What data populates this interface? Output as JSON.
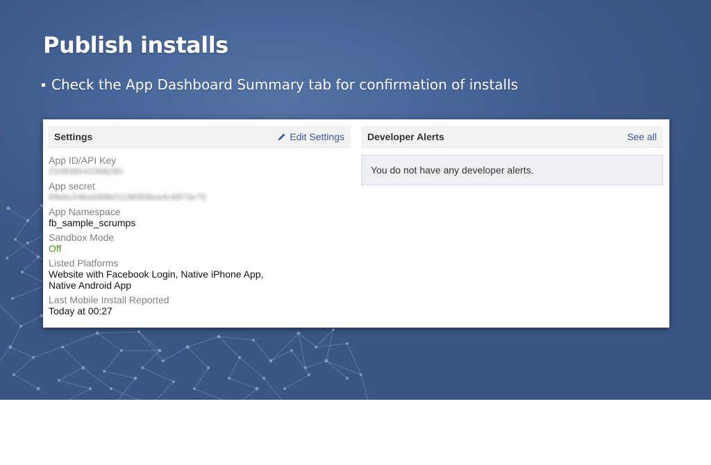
{
  "slide": {
    "title": "Publish installs",
    "bullet": "Check the App Dashboard Summary tab for confirmation of installs"
  },
  "settings": {
    "title": "Settings",
    "edit_link": "Edit Settings",
    "edit_icon": "pencil-icon",
    "fields": [
      {
        "label": "App ID/API Key",
        "value": "233936543368280"
      },
      {
        "label": "App secret",
        "value": "89ebc04ba569b01196909ea4c6873e75"
      },
      {
        "label": "App Namespace",
        "value": "fb_sample_scrumps"
      },
      {
        "label": "Sandbox Mode",
        "value": "Off"
      },
      {
        "label": "Listed Platforms",
        "value": "Website with Facebook Login, Native iPhone App,",
        "value2": "Native Android App"
      },
      {
        "label": "Last Mobile Install Reported",
        "value": "Today at 00:27"
      }
    ]
  },
  "alerts": {
    "title": "Developer Alerts",
    "see_all": "See all",
    "message": "You do not have any developer alerts."
  },
  "colors": {
    "slide_background": "#3e5b8b",
    "link": "#3b5998",
    "sandbox_off": "#3e9c1a",
    "label_gray": "#808080"
  }
}
